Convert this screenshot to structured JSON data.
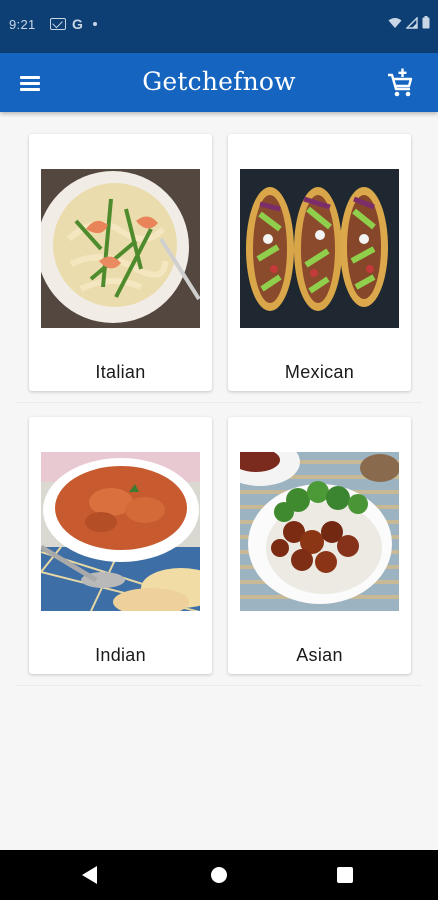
{
  "status_bar": {
    "time": "9:21",
    "google_letter": "G",
    "icons": [
      "gmail-icon",
      "google-icon",
      "notification-dot-icon",
      "wifi-icon",
      "signal-icon",
      "battery-icon"
    ]
  },
  "app_bar": {
    "title": "Getchefnow",
    "menu_icon": "hamburger-menu-icon",
    "cart_icon": "add-to-cart-icon",
    "background_color": "#1565c0",
    "status_bar_color": "#0d3f75"
  },
  "categories": [
    {
      "label": "Italian",
      "image": "shrimp-pasta-photo"
    },
    {
      "label": "Mexican",
      "image": "tacos-photo"
    },
    {
      "label": "Indian",
      "image": "curry-naan-photo"
    },
    {
      "label": "Asian",
      "image": "chicken-rice-broccoli-photo"
    }
  ],
  "nav_bar": {
    "icons": [
      "back-triangle-icon",
      "home-circle-icon",
      "recents-square-icon"
    ]
  }
}
